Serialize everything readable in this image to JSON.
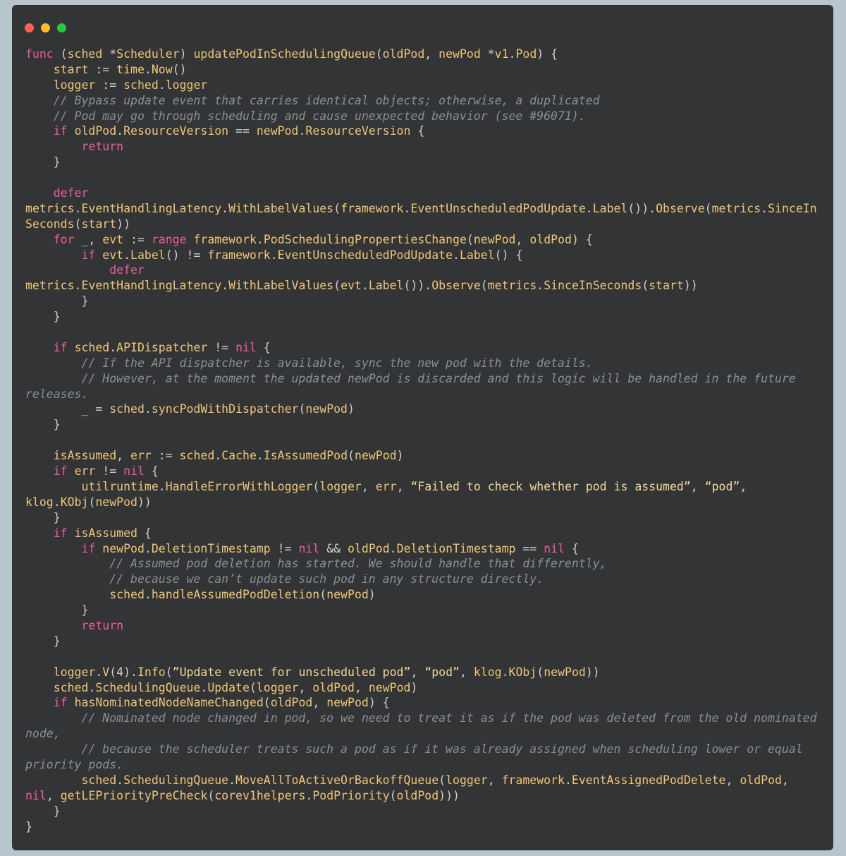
{
  "window": {
    "controls": [
      {
        "name": "close-dot",
        "color": "#fe5f57"
      },
      {
        "name": "minimize-dot",
        "color": "#febc2e"
      },
      {
        "name": "maximize-dot",
        "color": "#27c840"
      }
    ]
  },
  "colors": {
    "background": "#b8c5cd",
    "editor": "#333436",
    "keyword": "#ee5d99",
    "identifier": "#f0c677",
    "comment": "#8a8f94",
    "plain": "#cfcfc8"
  },
  "code": {
    "lines": [
      [
        [
          "kw",
          "func"
        ],
        [
          "p",
          " ("
        ],
        [
          "fn",
          "sched"
        ],
        [
          "p",
          " *"
        ],
        [
          "fn",
          "Scheduler"
        ],
        [
          "p",
          ") "
        ],
        [
          "fn",
          "updatePodInSchedulingQueue"
        ],
        [
          "p",
          "("
        ],
        [
          "fn",
          "oldPod"
        ],
        [
          "p",
          ", "
        ],
        [
          "fn",
          "newPod"
        ],
        [
          "p",
          " *"
        ],
        [
          "fn",
          "v1"
        ],
        [
          "p",
          "."
        ],
        [
          "fn",
          "Pod"
        ],
        [
          "p",
          ") {"
        ]
      ],
      [
        [
          "p",
          "    "
        ],
        [
          "fn",
          "start"
        ],
        [
          "p",
          " := "
        ],
        [
          "fn",
          "time"
        ],
        [
          "p",
          "."
        ],
        [
          "fn",
          "Now"
        ],
        [
          "p",
          "()"
        ]
      ],
      [
        [
          "p",
          "    "
        ],
        [
          "fn",
          "logger"
        ],
        [
          "p",
          " := "
        ],
        [
          "fn",
          "sched"
        ],
        [
          "p",
          "."
        ],
        [
          "fn",
          "logger"
        ]
      ],
      [
        [
          "p",
          "    "
        ],
        [
          "cm",
          "// Bypass update event that carries identical objects; otherwise, a duplicated"
        ]
      ],
      [
        [
          "p",
          "    "
        ],
        [
          "cm",
          "// Pod may go through scheduling and cause unexpected behavior (see #96071)."
        ]
      ],
      [
        [
          "p",
          "    "
        ],
        [
          "kw",
          "if"
        ],
        [
          "p",
          " "
        ],
        [
          "fn",
          "oldPod"
        ],
        [
          "p",
          "."
        ],
        [
          "fn",
          "ResourceVersion"
        ],
        [
          "p",
          " == "
        ],
        [
          "fn",
          "newPod"
        ],
        [
          "p",
          "."
        ],
        [
          "fn",
          "ResourceVersion"
        ],
        [
          "p",
          " {"
        ]
      ],
      [
        [
          "p",
          "        "
        ],
        [
          "kw",
          "return"
        ]
      ],
      [
        [
          "p",
          "    }"
        ]
      ],
      [
        [
          "p",
          ""
        ]
      ],
      [
        [
          "p",
          "    "
        ],
        [
          "kw",
          "defer"
        ]
      ],
      [
        [
          "fn",
          "metrics"
        ],
        [
          "p",
          "."
        ],
        [
          "fn",
          "EventHandlingLatency"
        ],
        [
          "p",
          "."
        ],
        [
          "fn",
          "WithLabelValues"
        ],
        [
          "p",
          "("
        ],
        [
          "fn",
          "framework"
        ],
        [
          "p",
          "."
        ],
        [
          "fn",
          "EventUnscheduledPodUpdate"
        ],
        [
          "p",
          "."
        ],
        [
          "fn",
          "Label"
        ],
        [
          "p",
          "())."
        ],
        [
          "fn",
          "Observe"
        ],
        [
          "p",
          "("
        ],
        [
          "fn",
          "metrics"
        ],
        [
          "p",
          "."
        ],
        [
          "fn",
          "SinceIn"
        ]
      ],
      [
        [
          "fn",
          "Seconds"
        ],
        [
          "p",
          "("
        ],
        [
          "fn",
          "start"
        ],
        [
          "p",
          "))"
        ]
      ],
      [
        [
          "p",
          "    "
        ],
        [
          "kw",
          "for"
        ],
        [
          "p",
          " _, "
        ],
        [
          "fn",
          "evt"
        ],
        [
          "p",
          " := "
        ],
        [
          "kw",
          "range"
        ],
        [
          "p",
          " "
        ],
        [
          "fn",
          "framework"
        ],
        [
          "p",
          "."
        ],
        [
          "fn",
          "PodSchedulingPropertiesChange"
        ],
        [
          "p",
          "("
        ],
        [
          "fn",
          "newPod"
        ],
        [
          "p",
          ", "
        ],
        [
          "fn",
          "oldPod"
        ],
        [
          "p",
          ") {"
        ]
      ],
      [
        [
          "p",
          "        "
        ],
        [
          "kw",
          "if"
        ],
        [
          "p",
          " "
        ],
        [
          "fn",
          "evt"
        ],
        [
          "p",
          "."
        ],
        [
          "fn",
          "Label"
        ],
        [
          "p",
          "() != "
        ],
        [
          "fn",
          "framework"
        ],
        [
          "p",
          "."
        ],
        [
          "fn",
          "EventUnscheduledPodUpdate"
        ],
        [
          "p",
          "."
        ],
        [
          "fn",
          "Label"
        ],
        [
          "p",
          "() {"
        ]
      ],
      [
        [
          "p",
          "            "
        ],
        [
          "kw",
          "defer"
        ]
      ],
      [
        [
          "fn",
          "metrics"
        ],
        [
          "p",
          "."
        ],
        [
          "fn",
          "EventHandlingLatency"
        ],
        [
          "p",
          "."
        ],
        [
          "fn",
          "WithLabelValues"
        ],
        [
          "p",
          "("
        ],
        [
          "fn",
          "evt"
        ],
        [
          "p",
          "."
        ],
        [
          "fn",
          "Label"
        ],
        [
          "p",
          "())."
        ],
        [
          "fn",
          "Observe"
        ],
        [
          "p",
          "("
        ],
        [
          "fn",
          "metrics"
        ],
        [
          "p",
          "."
        ],
        [
          "fn",
          "SinceInSeconds"
        ],
        [
          "p",
          "("
        ],
        [
          "fn",
          "start"
        ],
        [
          "p",
          "))"
        ]
      ],
      [
        [
          "p",
          "        }"
        ]
      ],
      [
        [
          "p",
          "    }"
        ]
      ],
      [
        [
          "p",
          ""
        ]
      ],
      [
        [
          "p",
          "    "
        ],
        [
          "kw",
          "if"
        ],
        [
          "p",
          " "
        ],
        [
          "fn",
          "sched"
        ],
        [
          "p",
          "."
        ],
        [
          "fn",
          "APIDispatcher"
        ],
        [
          "p",
          " != "
        ],
        [
          "kw",
          "nil"
        ],
        [
          "p",
          " {"
        ]
      ],
      [
        [
          "p",
          "        "
        ],
        [
          "cm",
          "// If the API dispatcher is available, sync the new pod with the details."
        ]
      ],
      [
        [
          "p",
          "        "
        ],
        [
          "cm",
          "// However, at the moment the updated newPod is discarded and this logic will be handled in the future"
        ]
      ],
      [
        [
          "cm",
          "releases."
        ]
      ],
      [
        [
          "p",
          "        _ = "
        ],
        [
          "fn",
          "sched"
        ],
        [
          "p",
          "."
        ],
        [
          "fn",
          "syncPodWithDispatcher"
        ],
        [
          "p",
          "("
        ],
        [
          "fn",
          "newPod"
        ],
        [
          "p",
          ")"
        ]
      ],
      [
        [
          "p",
          "    }"
        ]
      ],
      [
        [
          "p",
          ""
        ]
      ],
      [
        [
          "p",
          "    "
        ],
        [
          "fn",
          "isAssumed"
        ],
        [
          "p",
          ", "
        ],
        [
          "fn",
          "err"
        ],
        [
          "p",
          " := "
        ],
        [
          "fn",
          "sched"
        ],
        [
          "p",
          "."
        ],
        [
          "fn",
          "Cache"
        ],
        [
          "p",
          "."
        ],
        [
          "fn",
          "IsAssumedPod"
        ],
        [
          "p",
          "("
        ],
        [
          "fn",
          "newPod"
        ],
        [
          "p",
          ")"
        ]
      ],
      [
        [
          "p",
          "    "
        ],
        [
          "kw",
          "if"
        ],
        [
          "p",
          " "
        ],
        [
          "fn",
          "err"
        ],
        [
          "p",
          " != "
        ],
        [
          "kw",
          "nil"
        ],
        [
          "p",
          " {"
        ]
      ],
      [
        [
          "p",
          "        "
        ],
        [
          "fn",
          "utilruntime"
        ],
        [
          "p",
          "."
        ],
        [
          "fn",
          "HandleErrorWithLogger"
        ],
        [
          "p",
          "("
        ],
        [
          "fn",
          "logger"
        ],
        [
          "p",
          ", "
        ],
        [
          "fn",
          "err"
        ],
        [
          "p",
          ", "
        ],
        [
          "st",
          "“Failed to check whether pod is assumed”"
        ],
        [
          "p",
          ", "
        ],
        [
          "st",
          "“pod”"
        ],
        [
          "p",
          ","
        ]
      ],
      [
        [
          "fn",
          "klog"
        ],
        [
          "p",
          "."
        ],
        [
          "fn",
          "KObj"
        ],
        [
          "p",
          "("
        ],
        [
          "fn",
          "newPod"
        ],
        [
          "p",
          "))"
        ]
      ],
      [
        [
          "p",
          "    }"
        ]
      ],
      [
        [
          "p",
          "    "
        ],
        [
          "kw",
          "if"
        ],
        [
          "p",
          " "
        ],
        [
          "fn",
          "isAssumed"
        ],
        [
          "p",
          " {"
        ]
      ],
      [
        [
          "p",
          "        "
        ],
        [
          "kw",
          "if"
        ],
        [
          "p",
          " "
        ],
        [
          "fn",
          "newPod"
        ],
        [
          "p",
          "."
        ],
        [
          "fn",
          "DeletionTimestamp"
        ],
        [
          "p",
          " != "
        ],
        [
          "kw",
          "nil"
        ],
        [
          "p",
          " && "
        ],
        [
          "fn",
          "oldPod"
        ],
        [
          "p",
          "."
        ],
        [
          "fn",
          "DeletionTimestamp"
        ],
        [
          "p",
          " == "
        ],
        [
          "kw",
          "nil"
        ],
        [
          "p",
          " {"
        ]
      ],
      [
        [
          "p",
          "            "
        ],
        [
          "cm",
          "// Assumed pod deletion has started. We should handle that differently,"
        ]
      ],
      [
        [
          "p",
          "            "
        ],
        [
          "cm",
          "// because we can’t update such pod in any structure directly."
        ]
      ],
      [
        [
          "p",
          "            "
        ],
        [
          "fn",
          "sched"
        ],
        [
          "p",
          "."
        ],
        [
          "fn",
          "handleAssumedPodDeletion"
        ],
        [
          "p",
          "("
        ],
        [
          "fn",
          "newPod"
        ],
        [
          "p",
          ")"
        ]
      ],
      [
        [
          "p",
          "        }"
        ]
      ],
      [
        [
          "p",
          "        "
        ],
        [
          "kw",
          "return"
        ]
      ],
      [
        [
          "p",
          "    }"
        ]
      ],
      [
        [
          "p",
          ""
        ]
      ],
      [
        [
          "p",
          "    "
        ],
        [
          "fn",
          "logger"
        ],
        [
          "p",
          "."
        ],
        [
          "fn",
          "V"
        ],
        [
          "p",
          "(4)."
        ],
        [
          "fn",
          "Info"
        ],
        [
          "p",
          "("
        ],
        [
          "st",
          "”Update event for unscheduled pod”"
        ],
        [
          "p",
          ", "
        ],
        [
          "st",
          "“pod”"
        ],
        [
          "p",
          ", "
        ],
        [
          "fn",
          "klog"
        ],
        [
          "p",
          "."
        ],
        [
          "fn",
          "KObj"
        ],
        [
          "p",
          "("
        ],
        [
          "fn",
          "newPod"
        ],
        [
          "p",
          "))"
        ]
      ],
      [
        [
          "p",
          "    "
        ],
        [
          "fn",
          "sched"
        ],
        [
          "p",
          "."
        ],
        [
          "fn",
          "SchedulingQueue"
        ],
        [
          "p",
          "."
        ],
        [
          "fn",
          "Update"
        ],
        [
          "p",
          "("
        ],
        [
          "fn",
          "logger"
        ],
        [
          "p",
          ", "
        ],
        [
          "fn",
          "oldPod"
        ],
        [
          "p",
          ", "
        ],
        [
          "fn",
          "newPod"
        ],
        [
          "p",
          ")"
        ]
      ],
      [
        [
          "p",
          "    "
        ],
        [
          "kw",
          "if"
        ],
        [
          "p",
          " "
        ],
        [
          "fn",
          "hasNominatedNodeNameChanged"
        ],
        [
          "p",
          "("
        ],
        [
          "fn",
          "oldPod"
        ],
        [
          "p",
          ", "
        ],
        [
          "fn",
          "newPod"
        ],
        [
          "p",
          ") {"
        ]
      ],
      [
        [
          "p",
          "        "
        ],
        [
          "cm",
          "// Nominated node changed in pod, so we need to treat it as if the pod was deleted from the old nominated"
        ]
      ],
      [
        [
          "cm",
          "node,"
        ]
      ],
      [
        [
          "p",
          "        "
        ],
        [
          "cm",
          "// because the scheduler treats such a pod as if it was already assigned when scheduling lower or equal"
        ]
      ],
      [
        [
          "cm",
          "priority pods."
        ]
      ],
      [
        [
          "p",
          "        "
        ],
        [
          "fn",
          "sched"
        ],
        [
          "p",
          "."
        ],
        [
          "fn",
          "SchedulingQueue"
        ],
        [
          "p",
          "."
        ],
        [
          "fn",
          "MoveAllToActiveOrBackoffQueue"
        ],
        [
          "p",
          "("
        ],
        [
          "fn",
          "logger"
        ],
        [
          "p",
          ", "
        ],
        [
          "fn",
          "framework"
        ],
        [
          "p",
          "."
        ],
        [
          "fn",
          "EventAssignedPodDelete"
        ],
        [
          "p",
          ", "
        ],
        [
          "fn",
          "oldPod"
        ],
        [
          "p",
          ","
        ]
      ],
      [
        [
          "kw",
          "nil"
        ],
        [
          "p",
          ", "
        ],
        [
          "fn",
          "getLEPriorityPreCheck"
        ],
        [
          "p",
          "("
        ],
        [
          "fn",
          "corev1helpers"
        ],
        [
          "p",
          "."
        ],
        [
          "fn",
          "PodPriority"
        ],
        [
          "p",
          "("
        ],
        [
          "fn",
          "oldPod"
        ],
        [
          "p",
          ")))"
        ]
      ],
      [
        [
          "p",
          "    }"
        ]
      ],
      [
        [
          "p",
          "}"
        ]
      ]
    ]
  }
}
